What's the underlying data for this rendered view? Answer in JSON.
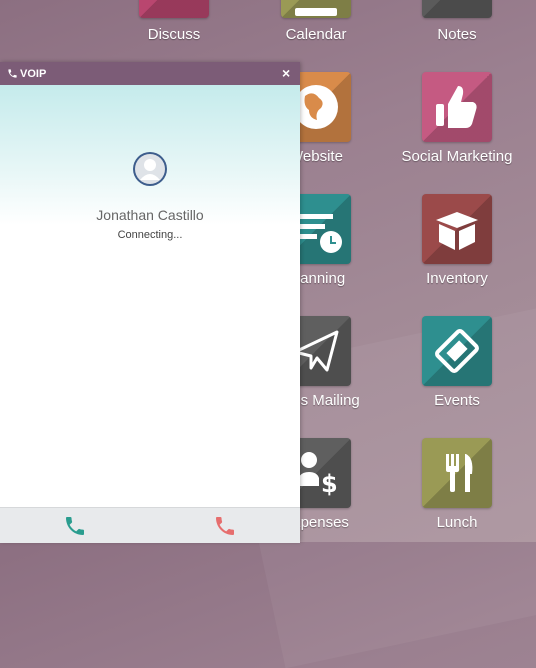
{
  "apps": [
    {
      "label": "Discuss",
      "color": "#b9466f",
      "icon": "chat-icon"
    },
    {
      "label": "Calendar",
      "color": "#9a9a55",
      "icon": "calendar-icon"
    },
    {
      "label": "Notes",
      "color": "#5b5b5b",
      "icon": "notes-icon"
    },
    {
      "label": "Website",
      "color": "#d98b4a",
      "icon": "globe-icon"
    },
    {
      "label": "Social Marketing",
      "color": "#c55a82",
      "icon": "thumbs-up-icon"
    },
    {
      "label": "Planning",
      "color": "#2e8f8f",
      "icon": "planning-icon"
    },
    {
      "label": "Inventory",
      "color": "#9b4a4a",
      "icon": "box-icon"
    },
    {
      "label": "Mass Mailing",
      "color": "#5f5f5f",
      "icon": "paper-plane-icon"
    },
    {
      "label": "Events",
      "color": "#2e8f8f",
      "icon": "ticket-icon"
    },
    {
      "label": "Expenses",
      "color": "#5f5f5f",
      "icon": "expenses-icon"
    },
    {
      "label": "Lunch",
      "color": "#9a9a55",
      "icon": "fork-knife-icon"
    }
  ],
  "voip": {
    "title": "VOIP",
    "close": "×",
    "contact_name": "Jonathan Castillo",
    "status": "Connecting...",
    "accept_color": "#2a9d8f",
    "hangup_color": "#e66e6e"
  }
}
